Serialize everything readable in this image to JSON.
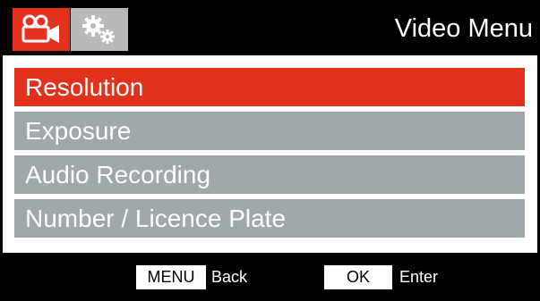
{
  "header": {
    "title": "Video Menu",
    "tabs": [
      {
        "icon": "video-camera-icon",
        "active": true
      },
      {
        "icon": "gears-icon",
        "active": false
      }
    ]
  },
  "menu": {
    "items": [
      {
        "label": "Resolution",
        "selected": true
      },
      {
        "label": "Exposure",
        "selected": false
      },
      {
        "label": "Audio Recording",
        "selected": false
      },
      {
        "label": "Number / Licence Plate",
        "selected": false
      }
    ]
  },
  "footer": {
    "menu_key": "MENU",
    "menu_action": "Back",
    "ok_key": "OK",
    "ok_action": "Enter"
  },
  "colors": {
    "accent": "#e2311d",
    "item_bg": "#a0a8ab",
    "bar_bg": "#000000",
    "inactive_tab": "#b9b9b9"
  }
}
